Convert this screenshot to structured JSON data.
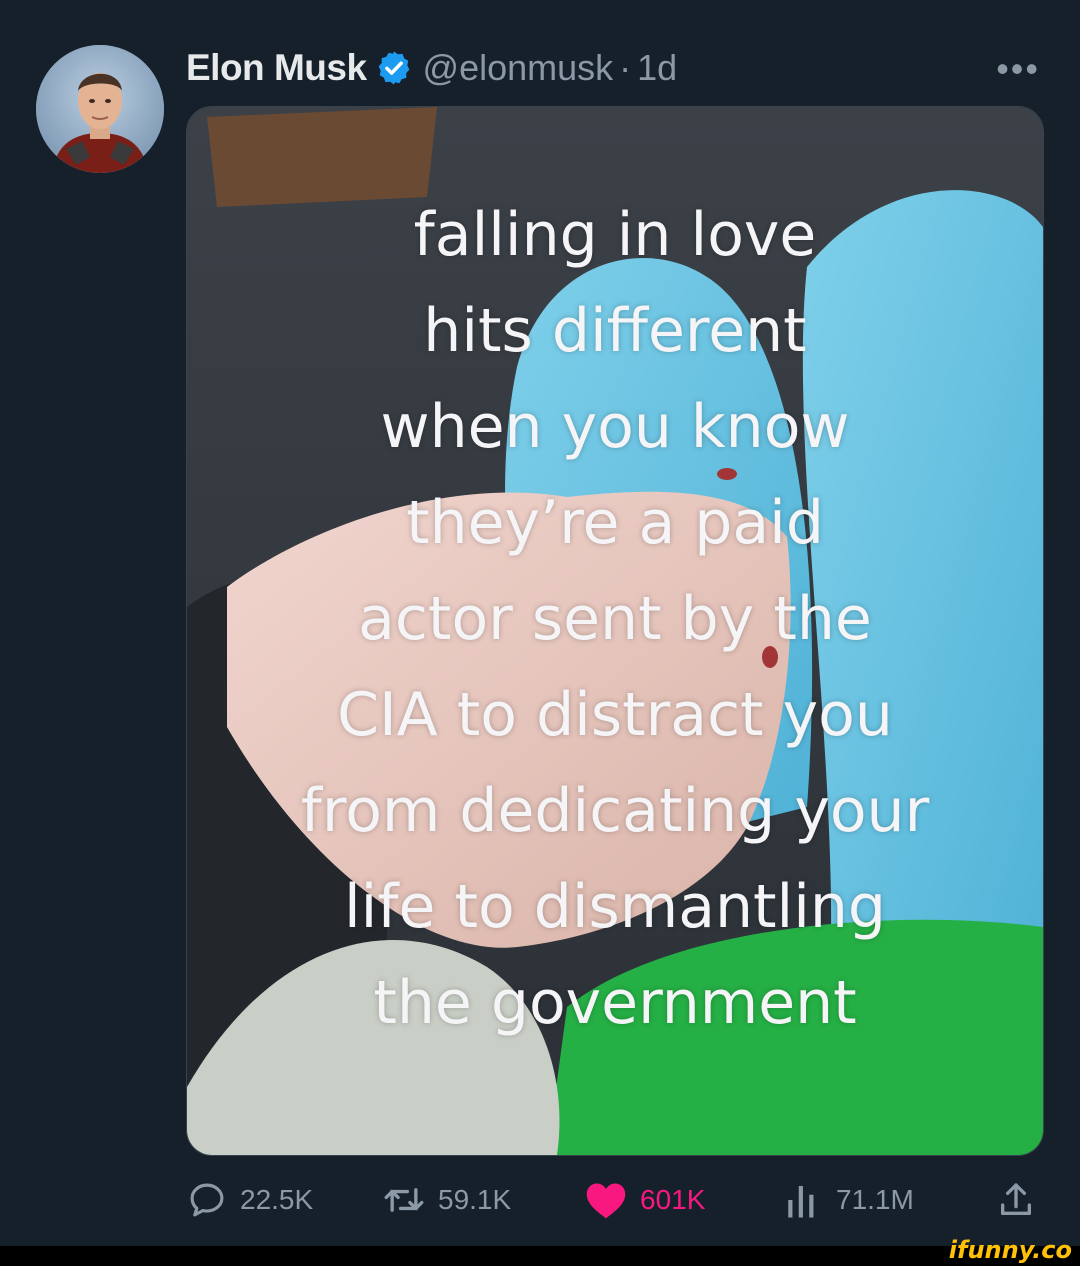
{
  "tweet": {
    "author_name": "Elon Musk",
    "handle": "@elonmusk",
    "separator": "·",
    "time": "1d",
    "more_label": "•••",
    "media_caption_lines": [
      "falling in love",
      "hits different",
      "when you know",
      "they’re a paid",
      "actor sent by the",
      "CIA to distract you",
      "from dedicating your",
      "life to dismantling",
      "the government"
    ]
  },
  "actions": {
    "replies": "22.5K",
    "reposts": "59.1K",
    "likes": "601K",
    "views": "71.1M"
  },
  "watermark": "ifunny.co",
  "colors": {
    "background": "#15202b",
    "verified": "#1d9bf0",
    "like": "#f91880",
    "muted": "#8b98a5"
  }
}
